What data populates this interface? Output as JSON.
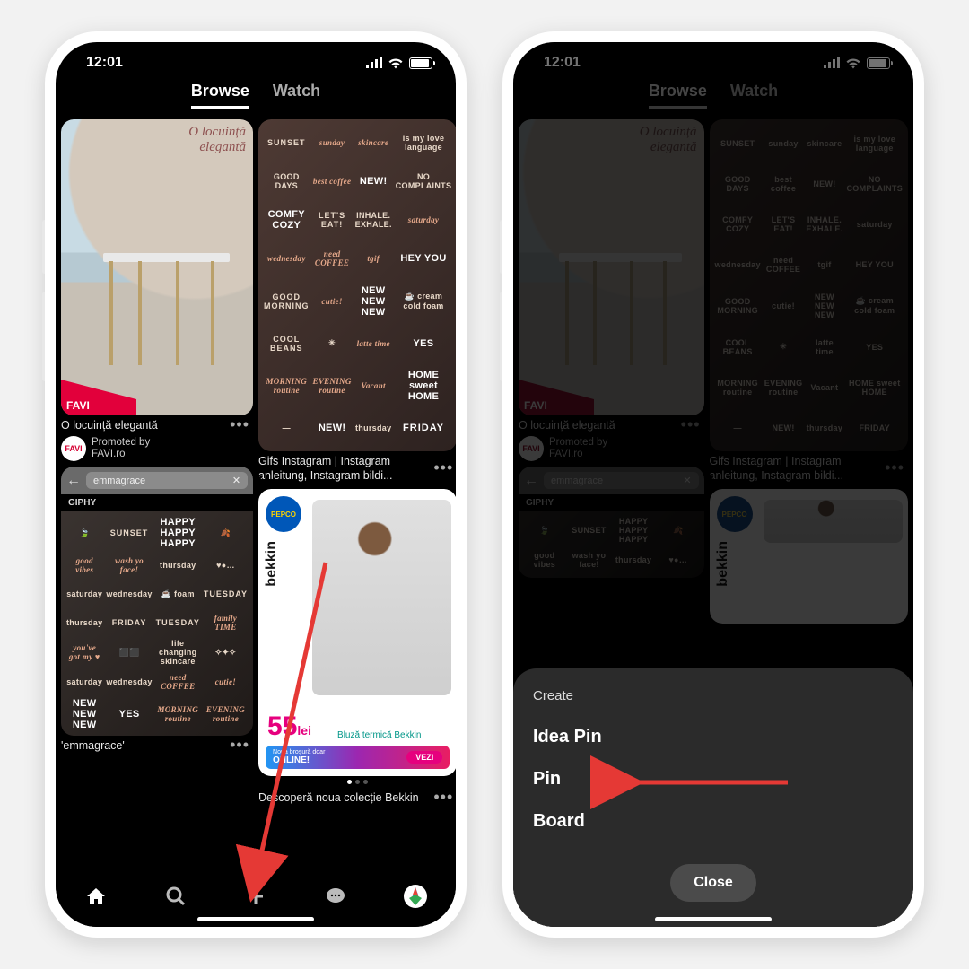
{
  "status": {
    "time": "12:01"
  },
  "tabs": {
    "browse": "Browse",
    "watch": "Watch"
  },
  "pins": {
    "favi": {
      "overlay_line1": "O locuință",
      "overlay_line2": "elegantă",
      "badge": "FAVI",
      "title": "O locuință elegantă",
      "promo_label": "Promoted by",
      "promoter": "FAVI.ro"
    },
    "right1": {
      "title": "Gifs Instagram | Instagram anleitung, Instagram bildi..."
    },
    "giphy": {
      "query": "emmagrace",
      "brand": "GIPHY",
      "title": "'emmagrace'"
    },
    "pepco": {
      "brand": "bekkin",
      "logo": "PEPCO",
      "price": "55",
      "currency": "lei",
      "sub": "Bluză termică Bekkin",
      "online_pre": "Noua broșură doar",
      "online": "ONLINE!",
      "cta": "VEZI",
      "title": "Descoperă noua colecție Bekkin"
    }
  },
  "stickers": {
    "row1": [
      "SUNSET",
      "sunday",
      "skincare",
      "is my love language"
    ],
    "row2": [
      "GOOD DAYS",
      "best coffee",
      "NEW!",
      "NO COMPLAINTS"
    ],
    "row3": [
      "COMFY COZY",
      "LET'S EAT!",
      "INHALE. EXHALE.",
      "saturday"
    ],
    "row4": [
      "wednesday",
      "need COFFEE",
      "tgif",
      "HEY YOU"
    ],
    "row5": [
      "GOOD MORNING",
      "cutie!",
      "NEW NEW NEW",
      "☕ cream cold foam"
    ],
    "row6": [
      "COOL BEANS",
      "✳",
      "latte time",
      "YES"
    ],
    "row7": [
      "MORNING routine",
      "EVENING routine",
      "Vacant",
      "HOME sweet HOME"
    ],
    "row8": [
      "—",
      "NEW!",
      "thursday",
      "FRIDAY"
    ]
  },
  "stickers2": {
    "row1": [
      "🍃",
      "SUNSET",
      "HAPPY HAPPY HAPPY",
      "🍂"
    ],
    "row2": [
      "good vibes",
      "wash yo face!",
      "thursday",
      "♥●…"
    ],
    "row3": [
      "saturday",
      "wednesday",
      "☕ foam",
      "TUESDAY"
    ],
    "row4": [
      "thursday",
      "FRIDAY",
      "TUESDAY",
      "family TIME"
    ],
    "row5": [
      "you've got my ♥",
      "⬛⬛",
      "life changing skincare",
      "✧✦✧"
    ],
    "row6": [
      "saturday",
      "wednesday",
      "need COFFEE",
      "cutie!"
    ],
    "row7": [
      "NEW NEW NEW",
      "YES",
      "MORNING routine",
      "EVENING routine"
    ]
  },
  "sheet": {
    "title": "Create",
    "opt1": "Idea Pin",
    "opt2": "Pin",
    "opt3": "Board",
    "close": "Close"
  }
}
